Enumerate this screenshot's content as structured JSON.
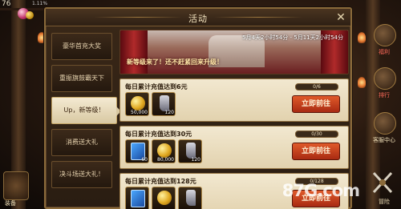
{
  "hud": {
    "level": "76",
    "exp_percent": "1.11%"
  },
  "dialog": {
    "title": "活动",
    "close_label": "✕"
  },
  "nav": [
    {
      "label": "豪华首充大奖",
      "active": false
    },
    {
      "label": "重振旗鼓霸天下",
      "active": false
    },
    {
      "label": "Up，新等级！",
      "active": true
    },
    {
      "label": "消费送大礼",
      "active": false
    },
    {
      "label": "决斗场送大礼！",
      "active": false
    }
  ],
  "banner": {
    "time": "5月4天2小时54分 - 5月11天2小时54分",
    "slogan": "新等级来了！还不赶紧回来升级！"
  },
  "rows": [
    {
      "title": "每日累计充值达到6元",
      "progress": "0/6",
      "progress_fraction": 0,
      "button": "立即前往",
      "items": [
        {
          "icon": "gold-coin-icon",
          "count": "50,000"
        },
        {
          "icon": "boot-icon",
          "count": "120"
        }
      ]
    },
    {
      "title": "每日累计充值达到30元",
      "progress": "0/30",
      "progress_fraction": 0,
      "button": "立即前往",
      "items": [
        {
          "icon": "book-icon",
          "count": "60"
        },
        {
          "icon": "gold-coin-icon",
          "count": "80,000"
        },
        {
          "icon": "boot-icon",
          "count": "120"
        }
      ]
    },
    {
      "title": "每日累计充值达到128元",
      "progress": "0/128",
      "progress_fraction": 0,
      "button": "立即前往",
      "items": [
        {
          "icon": "book-icon",
          "count": ""
        },
        {
          "icon": "gold-coin-icon",
          "count": ""
        },
        {
          "icon": "boot-icon",
          "count": ""
        }
      ]
    }
  ],
  "side": {
    "equip_label": "装备",
    "right_labels": [
      "福利",
      "排行",
      "客服中心"
    ],
    "exit_label": "冒险"
  },
  "watermark": "87G.com"
}
